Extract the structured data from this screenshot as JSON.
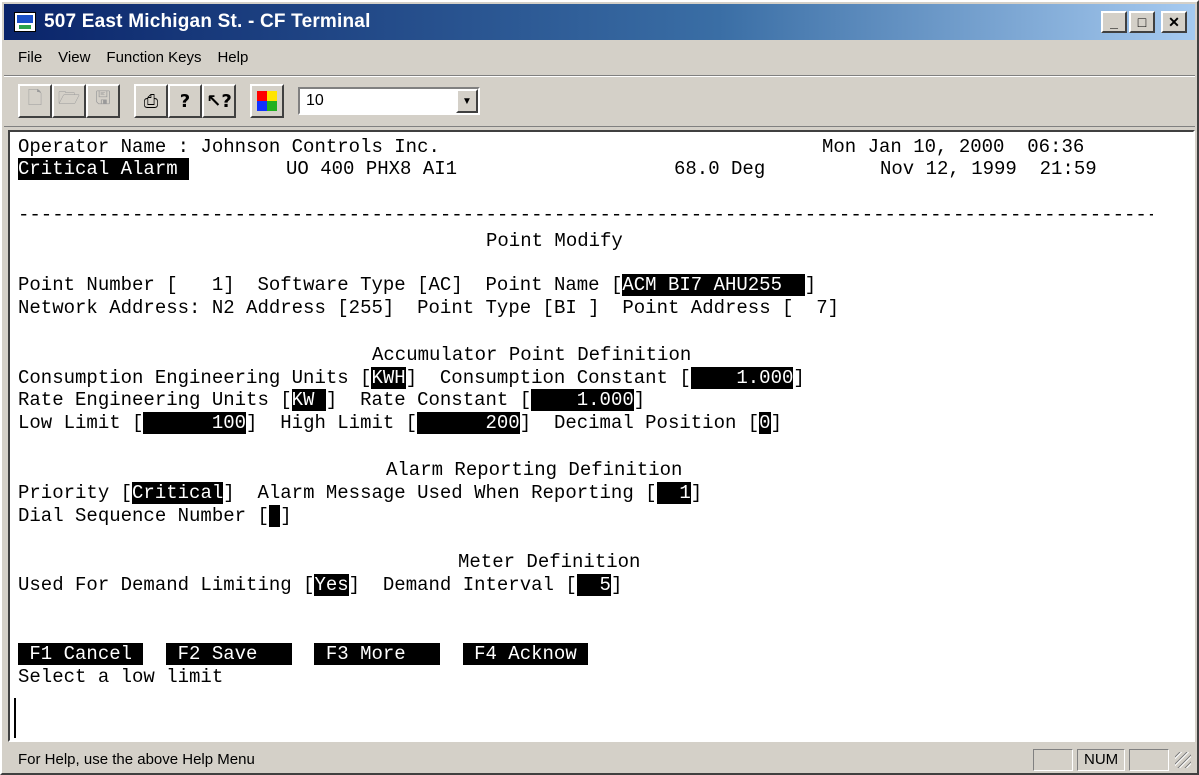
{
  "window": {
    "title": "507 East Michigan St. - CF Terminal"
  },
  "menu": [
    "File",
    "View",
    "Function Keys",
    "Help"
  ],
  "toolbar": {
    "combo_value": "10"
  },
  "terminal": {
    "line1": {
      "operator": "Operator Name : Johnson Controls Inc.",
      "date": "Mon Jan 10, 2000  06:36"
    },
    "line2": {
      "alarm_label": "Critical Alarm ",
      "point": "UO 400 PHX8 AI1",
      "value": "68.0 Deg",
      "date": "Nov 12, 1999  21:59"
    },
    "separator": "-----------------------------------------------------------------------------------------------------",
    "heading": "Point Modify",
    "point_number_label": "Point Number [",
    "point_number": "   1",
    "software_type_label": "Software Type [",
    "software_type": "AC",
    "point_name_label": "Point Name [",
    "point_name": "ACM BI7 AHU255  ",
    "network_address_label": "Network Address:",
    "n2_address_label": "N2 Address [",
    "n2_address": "255",
    "point_type_label": "Point Type [",
    "point_type": "BI ",
    "point_address_label": "Point Address [",
    "point_address": "  7",
    "accumulator_heading": "Accumulator Point Definition",
    "consumption_units_label": "Consumption Engineering Units [",
    "consumption_units": "KWH",
    "consumption_constant_label": "Consumption Constant [",
    "consumption_constant": "    1.000",
    "rate_units_label": "Rate Engineering Units [",
    "rate_units": "KW ",
    "rate_constant_label": "Rate Constant [",
    "rate_constant": "    1.000",
    "low_limit_label": "Low Limit [",
    "low_limit": "      100",
    "high_limit_label": "High Limit [",
    "high_limit": "      200",
    "decimal_position_label": "Decimal Position [",
    "decimal_position": "0",
    "alarm_heading": "Alarm Reporting Definition",
    "priority_label": "Priority [",
    "priority": "Critical",
    "alarm_message_label": "Alarm Message Used When Reporting [",
    "alarm_message": "  1",
    "dial_sequence_label": "Dial Sequence Number [",
    "dial_sequence": " ",
    "meter_heading": "Meter Definition",
    "demand_limiting_label": "Used For Demand Limiting [",
    "demand_limiting": "Yes",
    "demand_interval_label": "Demand Interval [",
    "demand_interval": "  5",
    "f1": " F1 Cancel ",
    "f2": " F2 Save   ",
    "f3": " F3 More   ",
    "f4": " F4 Acknow ",
    "prompt": "Select a low limit"
  },
  "status": {
    "text": "For Help, use the above Help Menu",
    "num": "NUM"
  }
}
